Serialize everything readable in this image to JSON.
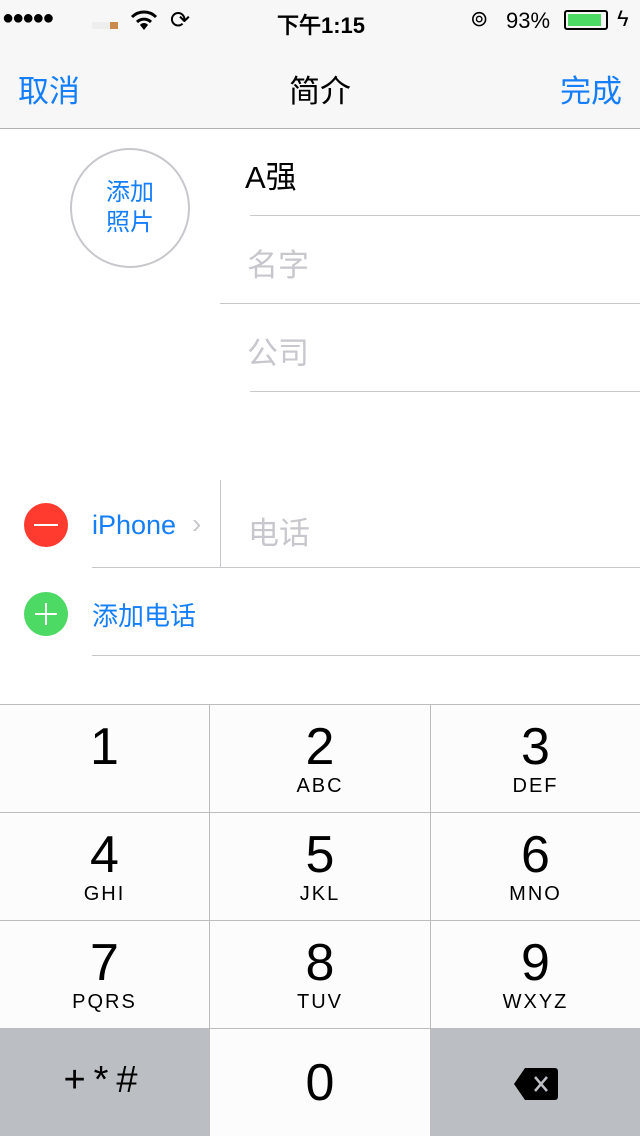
{
  "status": {
    "carrier_dots": "●●●●●",
    "time": "下午1:15",
    "battery": "93%",
    "battery_level": 0.93,
    "battery_color": "#4cd964"
  },
  "nav": {
    "cancel": "取消",
    "title": "简介",
    "done": "完成"
  },
  "photo": {
    "label_line1": "添加",
    "label_line2": "照片"
  },
  "fields": {
    "last_name": "A强",
    "first_name_placeholder": "名字",
    "company_placeholder": "公司"
  },
  "phone": {
    "label": "iPhone",
    "placeholder": "电话",
    "add_label": "添加电话"
  },
  "colors": {
    "accent": "#147efb",
    "remove": "#ff3b30",
    "add": "#4cd964"
  },
  "keypad": {
    "keys": [
      {
        "digit": "1",
        "letters": ""
      },
      {
        "digit": "2",
        "letters": "ABC"
      },
      {
        "digit": "3",
        "letters": "DEF"
      },
      {
        "digit": "4",
        "letters": "GHI"
      },
      {
        "digit": "5",
        "letters": "JKL"
      },
      {
        "digit": "6",
        "letters": "MNO"
      },
      {
        "digit": "7",
        "letters": "PQRS"
      },
      {
        "digit": "8",
        "letters": "TUV"
      },
      {
        "digit": "9",
        "letters": "WXYZ"
      }
    ],
    "symbols": "+*#",
    "zero": "0"
  }
}
